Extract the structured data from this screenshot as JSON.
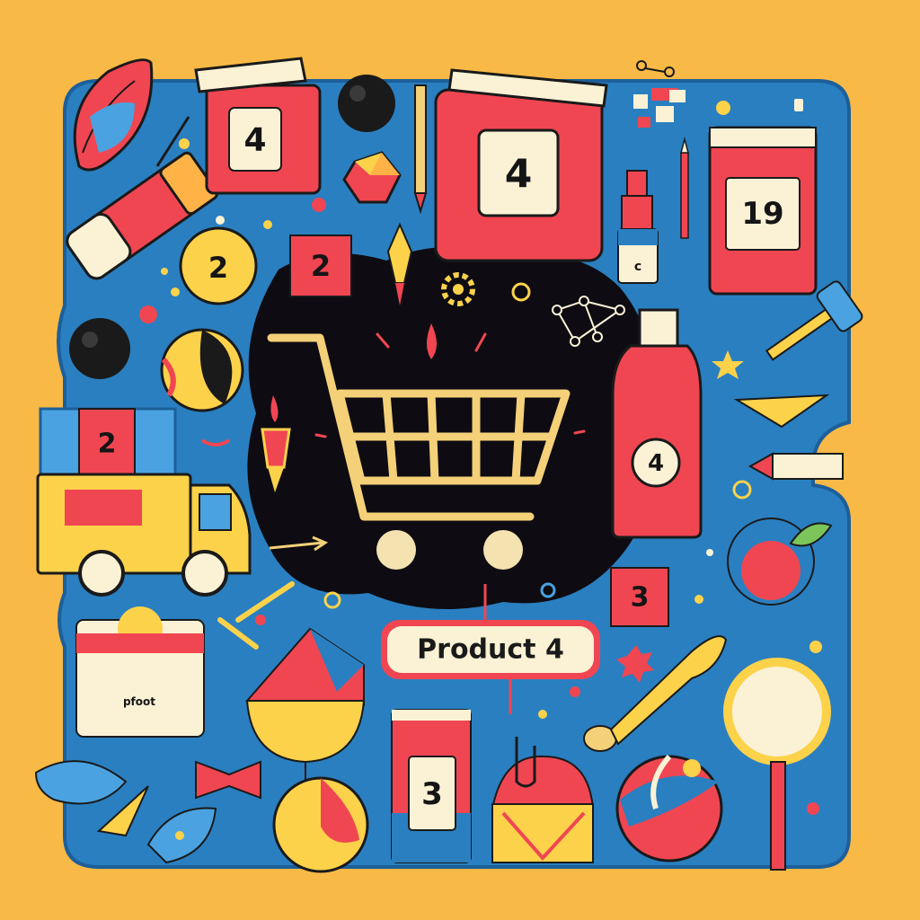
{
  "scene": {
    "colors": {
      "background": "#f9b946",
      "board": "#2a7fc0",
      "board_dark": "#1d5f9a",
      "center_blob": "#0e0c12",
      "red": "#f04652",
      "yellow": "#fcd24a",
      "cream": "#fbf2d6",
      "outline": "#1a1a1a"
    },
    "center_label": "Product 4",
    "cart_icon": "shopping-cart-icon"
  },
  "tiles": {
    "top_left_jar": "4",
    "top_center_bag": "4",
    "top_right_box": "19",
    "ball_left": "2",
    "box_left": "2",
    "truck_box": "2",
    "bottle_right": "4",
    "box_bottom_right": "3",
    "box_bottom_center": "3",
    "small_bottle": "c",
    "market_stand": "pfoot"
  }
}
